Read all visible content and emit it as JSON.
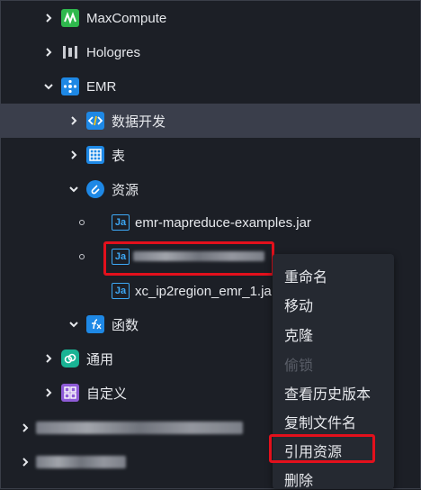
{
  "tree": {
    "maxcompute": "MaxCompute",
    "hologres": "Hologres",
    "emr": "EMR",
    "data_dev": "数据开发",
    "table": "表",
    "resource": "资源",
    "file1": "emr-mapreduce-examples.jar",
    "file3": "xc_ip2region_emr_1.ja",
    "function": "函数",
    "common": "通用",
    "custom": "自定义",
    "jar_badge": "Ja"
  },
  "context_menu": {
    "rename": "重命名",
    "move": "移动",
    "clone": "克隆",
    "steal": "偷锁",
    "history": "查看历史版本",
    "copy_name": "复制文件名",
    "reference": "引用资源",
    "delete": "删除"
  },
  "colors": {
    "background": "#1c1f26",
    "selected_row": "#3a3e4b",
    "menu_bg": "#252931",
    "highlight": "#e3101c",
    "jar_blue": "#3da8f5"
  }
}
